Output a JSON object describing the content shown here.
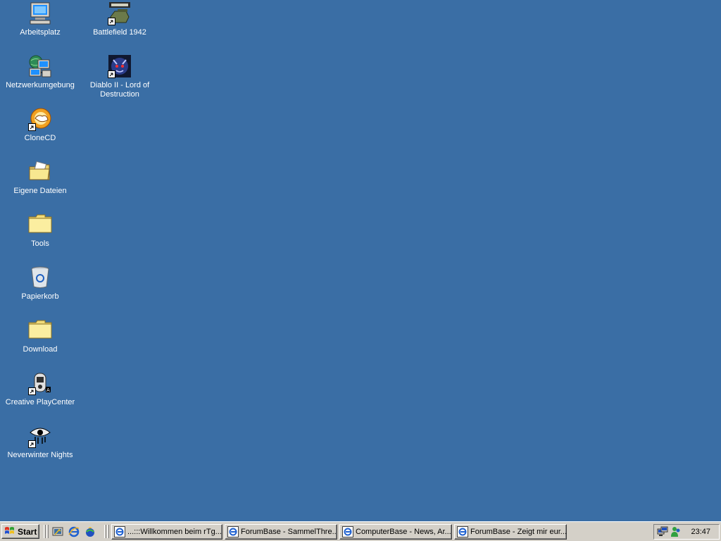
{
  "desktop": {
    "background": "#3a6ea5",
    "icons": [
      {
        "label": "Arbeitsplatz",
        "icon": "my-computer-icon"
      },
      {
        "label": "Battlefield 1942",
        "icon": "battlefield-1942-icon",
        "shortcut": true
      },
      {
        "label": "Netzwerkumgebung",
        "icon": "network-places-icon"
      },
      {
        "label": "Diablo II - Lord of Destruction",
        "icon": "diablo-ii-icon",
        "shortcut": true
      },
      {
        "label": "CloneCD",
        "icon": "clonecd-icon",
        "shortcut": true
      },
      {
        "label": "Eigene Dateien",
        "icon": "my-documents-icon"
      },
      {
        "label": "Tools",
        "icon": "folder-icon"
      },
      {
        "label": "Papierkorb",
        "icon": "recycle-bin-icon"
      },
      {
        "label": "Download",
        "icon": "folder-icon"
      },
      {
        "label": "Creative PlayCenter",
        "icon": "creative-playcenter-icon",
        "shortcut": true
      },
      {
        "label": "Neverwinter Nights",
        "icon": "neverwinter-nights-icon",
        "shortcut": true
      }
    ]
  },
  "taskbar": {
    "start_label": "Start",
    "quick_launch": [
      "show-desktop-icon",
      "internet-explorer-icon",
      "outlook-express-icon"
    ],
    "tasks": [
      {
        "label": "...:::Willkommen beim rTg..."
      },
      {
        "label": "ForumBase - SammelThre..."
      },
      {
        "label": "ComputerBase - News, Ar..."
      },
      {
        "label": "ForumBase - Zeigt mir eur..."
      }
    ],
    "tray": {
      "icons": [
        "network-connection-icon",
        "messenger-icon"
      ],
      "clock": "23:47"
    }
  }
}
